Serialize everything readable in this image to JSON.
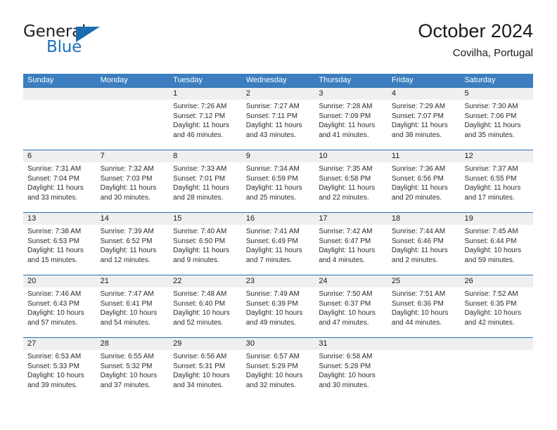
{
  "brand": {
    "name_part1": "General",
    "name_part2": "Blue",
    "triangle_color": "#1b6cb0",
    "text_color": "#231f20",
    "blue_color": "#1d71b8"
  },
  "header": {
    "title": "October 2024",
    "subtitle": "Covilha, Portugal"
  },
  "theme": {
    "header_band": "#3c7ebf",
    "row_divider": "#2f6fae",
    "daynum_band": "#efefef",
    "text": "#2b2b2b"
  },
  "weekdays": [
    "Sunday",
    "Monday",
    "Tuesday",
    "Wednesday",
    "Thursday",
    "Friday",
    "Saturday"
  ],
  "weeks": [
    {
      "daynums": [
        "",
        "",
        "1",
        "2",
        "3",
        "4",
        "5"
      ],
      "cells": [
        {
          "empty": true,
          "sunrise": "",
          "sunset": "",
          "daylight1": "",
          "daylight2": ""
        },
        {
          "empty": true,
          "sunrise": "",
          "sunset": "",
          "daylight1": "",
          "daylight2": ""
        },
        {
          "empty": false,
          "sunrise": "Sunrise: 7:26 AM",
          "sunset": "Sunset: 7:12 PM",
          "daylight1": "Daylight: 11 hours",
          "daylight2": "and 46 minutes."
        },
        {
          "empty": false,
          "sunrise": "Sunrise: 7:27 AM",
          "sunset": "Sunset: 7:11 PM",
          "daylight1": "Daylight: 11 hours",
          "daylight2": "and 43 minutes."
        },
        {
          "empty": false,
          "sunrise": "Sunrise: 7:28 AM",
          "sunset": "Sunset: 7:09 PM",
          "daylight1": "Daylight: 11 hours",
          "daylight2": "and 41 minutes."
        },
        {
          "empty": false,
          "sunrise": "Sunrise: 7:29 AM",
          "sunset": "Sunset: 7:07 PM",
          "daylight1": "Daylight: 11 hours",
          "daylight2": "and 38 minutes."
        },
        {
          "empty": false,
          "sunrise": "Sunrise: 7:30 AM",
          "sunset": "Sunset: 7:06 PM",
          "daylight1": "Daylight: 11 hours",
          "daylight2": "and 35 minutes."
        }
      ]
    },
    {
      "daynums": [
        "6",
        "7",
        "8",
        "9",
        "10",
        "11",
        "12"
      ],
      "cells": [
        {
          "empty": false,
          "sunrise": "Sunrise: 7:31 AM",
          "sunset": "Sunset: 7:04 PM",
          "daylight1": "Daylight: 11 hours",
          "daylight2": "and 33 minutes."
        },
        {
          "empty": false,
          "sunrise": "Sunrise: 7:32 AM",
          "sunset": "Sunset: 7:03 PM",
          "daylight1": "Daylight: 11 hours",
          "daylight2": "and 30 minutes."
        },
        {
          "empty": false,
          "sunrise": "Sunrise: 7:33 AM",
          "sunset": "Sunset: 7:01 PM",
          "daylight1": "Daylight: 11 hours",
          "daylight2": "and 28 minutes."
        },
        {
          "empty": false,
          "sunrise": "Sunrise: 7:34 AM",
          "sunset": "Sunset: 6:59 PM",
          "daylight1": "Daylight: 11 hours",
          "daylight2": "and 25 minutes."
        },
        {
          "empty": false,
          "sunrise": "Sunrise: 7:35 AM",
          "sunset": "Sunset: 6:58 PM",
          "daylight1": "Daylight: 11 hours",
          "daylight2": "and 22 minutes."
        },
        {
          "empty": false,
          "sunrise": "Sunrise: 7:36 AM",
          "sunset": "Sunset: 6:56 PM",
          "daylight1": "Daylight: 11 hours",
          "daylight2": "and 20 minutes."
        },
        {
          "empty": false,
          "sunrise": "Sunrise: 7:37 AM",
          "sunset": "Sunset: 6:55 PM",
          "daylight1": "Daylight: 11 hours",
          "daylight2": "and 17 minutes."
        }
      ]
    },
    {
      "daynums": [
        "13",
        "14",
        "15",
        "16",
        "17",
        "18",
        "19"
      ],
      "cells": [
        {
          "empty": false,
          "sunrise": "Sunrise: 7:38 AM",
          "sunset": "Sunset: 6:53 PM",
          "daylight1": "Daylight: 11 hours",
          "daylight2": "and 15 minutes."
        },
        {
          "empty": false,
          "sunrise": "Sunrise: 7:39 AM",
          "sunset": "Sunset: 6:52 PM",
          "daylight1": "Daylight: 11 hours",
          "daylight2": "and 12 minutes."
        },
        {
          "empty": false,
          "sunrise": "Sunrise: 7:40 AM",
          "sunset": "Sunset: 6:50 PM",
          "daylight1": "Daylight: 11 hours",
          "daylight2": "and 9 minutes."
        },
        {
          "empty": false,
          "sunrise": "Sunrise: 7:41 AM",
          "sunset": "Sunset: 6:49 PM",
          "daylight1": "Daylight: 11 hours",
          "daylight2": "and 7 minutes."
        },
        {
          "empty": false,
          "sunrise": "Sunrise: 7:42 AM",
          "sunset": "Sunset: 6:47 PM",
          "daylight1": "Daylight: 11 hours",
          "daylight2": "and 4 minutes."
        },
        {
          "empty": false,
          "sunrise": "Sunrise: 7:44 AM",
          "sunset": "Sunset: 6:46 PM",
          "daylight1": "Daylight: 11 hours",
          "daylight2": "and 2 minutes."
        },
        {
          "empty": false,
          "sunrise": "Sunrise: 7:45 AM",
          "sunset": "Sunset: 6:44 PM",
          "daylight1": "Daylight: 10 hours",
          "daylight2": "and 59 minutes."
        }
      ]
    },
    {
      "daynums": [
        "20",
        "21",
        "22",
        "23",
        "24",
        "25",
        "26"
      ],
      "cells": [
        {
          "empty": false,
          "sunrise": "Sunrise: 7:46 AM",
          "sunset": "Sunset: 6:43 PM",
          "daylight1": "Daylight: 10 hours",
          "daylight2": "and 57 minutes."
        },
        {
          "empty": false,
          "sunrise": "Sunrise: 7:47 AM",
          "sunset": "Sunset: 6:41 PM",
          "daylight1": "Daylight: 10 hours",
          "daylight2": "and 54 minutes."
        },
        {
          "empty": false,
          "sunrise": "Sunrise: 7:48 AM",
          "sunset": "Sunset: 6:40 PM",
          "daylight1": "Daylight: 10 hours",
          "daylight2": "and 52 minutes."
        },
        {
          "empty": false,
          "sunrise": "Sunrise: 7:49 AM",
          "sunset": "Sunset: 6:39 PM",
          "daylight1": "Daylight: 10 hours",
          "daylight2": "and 49 minutes."
        },
        {
          "empty": false,
          "sunrise": "Sunrise: 7:50 AM",
          "sunset": "Sunset: 6:37 PM",
          "daylight1": "Daylight: 10 hours",
          "daylight2": "and 47 minutes."
        },
        {
          "empty": false,
          "sunrise": "Sunrise: 7:51 AM",
          "sunset": "Sunset: 6:36 PM",
          "daylight1": "Daylight: 10 hours",
          "daylight2": "and 44 minutes."
        },
        {
          "empty": false,
          "sunrise": "Sunrise: 7:52 AM",
          "sunset": "Sunset: 6:35 PM",
          "daylight1": "Daylight: 10 hours",
          "daylight2": "and 42 minutes."
        }
      ]
    },
    {
      "daynums": [
        "27",
        "28",
        "29",
        "30",
        "31",
        "",
        ""
      ],
      "cells": [
        {
          "empty": false,
          "sunrise": "Sunrise: 6:53 AM",
          "sunset": "Sunset: 5:33 PM",
          "daylight1": "Daylight: 10 hours",
          "daylight2": "and 39 minutes."
        },
        {
          "empty": false,
          "sunrise": "Sunrise: 6:55 AM",
          "sunset": "Sunset: 5:32 PM",
          "daylight1": "Daylight: 10 hours",
          "daylight2": "and 37 minutes."
        },
        {
          "empty": false,
          "sunrise": "Sunrise: 6:56 AM",
          "sunset": "Sunset: 5:31 PM",
          "daylight1": "Daylight: 10 hours",
          "daylight2": "and 34 minutes."
        },
        {
          "empty": false,
          "sunrise": "Sunrise: 6:57 AM",
          "sunset": "Sunset: 5:29 PM",
          "daylight1": "Daylight: 10 hours",
          "daylight2": "and 32 minutes."
        },
        {
          "empty": false,
          "sunrise": "Sunrise: 6:58 AM",
          "sunset": "Sunset: 5:28 PM",
          "daylight1": "Daylight: 10 hours",
          "daylight2": "and 30 minutes."
        },
        {
          "empty": true,
          "sunrise": "",
          "sunset": "",
          "daylight1": "",
          "daylight2": ""
        },
        {
          "empty": true,
          "sunrise": "",
          "sunset": "",
          "daylight1": "",
          "daylight2": ""
        }
      ]
    }
  ]
}
